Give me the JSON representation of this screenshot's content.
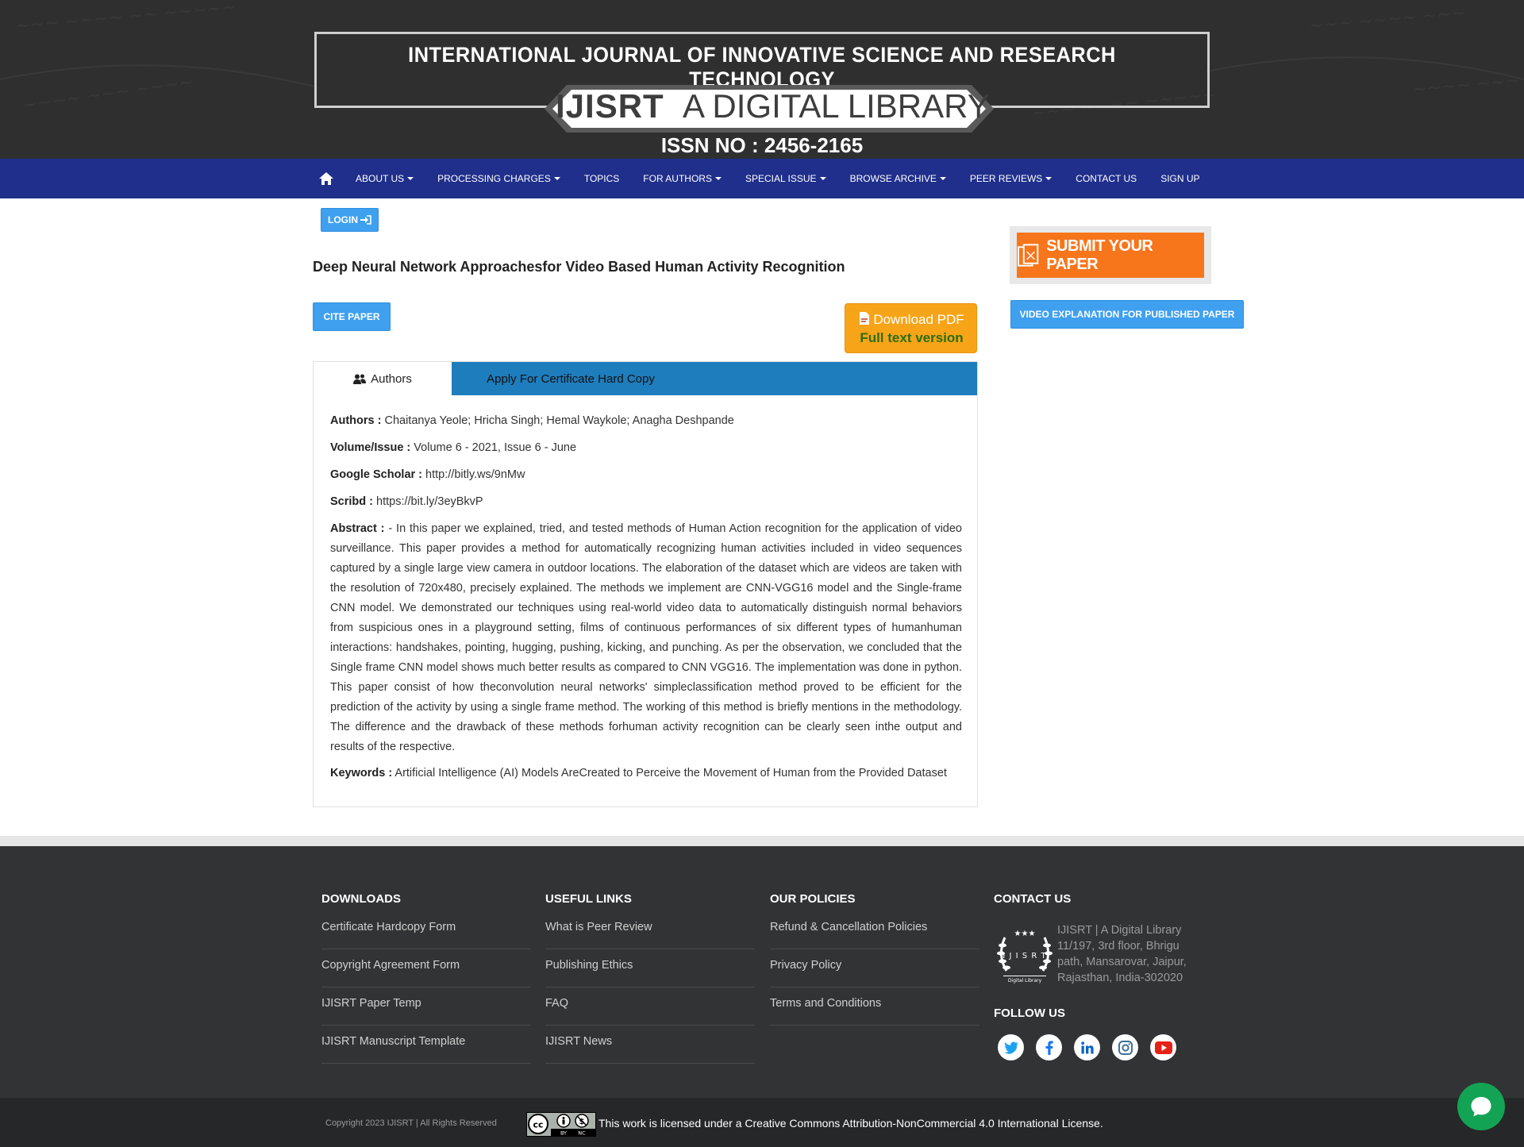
{
  "header": {
    "journal_title": "INTERNATIONAL JOURNAL OF INNOVATIVE SCIENCE AND RESEARCH TECHNOLOGY",
    "banner_abbrev": "IJISRT",
    "banner_text": "A DIGITAL LIBRARY",
    "issn": "ISSN NO : 2456-2165"
  },
  "nav": {
    "items": [
      {
        "label": "ABOUT US",
        "dropdown": true
      },
      {
        "label": "PROCESSING CHARGES",
        "dropdown": true
      },
      {
        "label": "TOPICS",
        "dropdown": false
      },
      {
        "label": "FOR AUTHORS",
        "dropdown": true
      },
      {
        "label": "SPECIAL ISSUE",
        "dropdown": true
      },
      {
        "label": "BROWSE ARCHIVE",
        "dropdown": true
      },
      {
        "label": "PEER REVIEWS",
        "dropdown": true
      },
      {
        "label": "CONTACT US",
        "dropdown": false
      },
      {
        "label": "SIGN UP",
        "dropdown": false
      }
    ]
  },
  "main": {
    "login_label": "LOGIN",
    "paper_title": "Deep Neural Network Approachesfor Video Based Human Activity Recognition",
    "cite_label": "CITE PAPER",
    "download_line1": "Download PDF",
    "download_line2": "Full text version",
    "tabs": [
      "Authors",
      "Apply For Certificate Hard Copy"
    ],
    "fields": {
      "authors_label": "Authors :",
      "authors_value": "Chaitanya Yeole; Hricha Singh; Hemal Waykole; Anagha Deshpande",
      "volume_label": "Volume/Issue :",
      "volume_value": "Volume 6 - 2021, Issue 6 - June",
      "scholar_label": "Google Scholar :",
      "scholar_value": "http://bitly.ws/9nMw",
      "scribd_label": "Scribd :",
      "scribd_value": "https://bit.ly/3eyBkvP",
      "abstract_label": "Abstract :",
      "abstract_value": "- In this paper we explained, tried, and tested methods of Human Action recognition for the application of video surveillance. This paper provides a method for automatically recognizing human activities included in video sequences captured by a single large view camera in outdoor locations. The elaboration of the dataset which are videos are taken with the resolution of 720x480, precisely explained. The methods we implement are CNN-VGG16 model and the Single-frame CNN model. We demonstrated our techniques using real-world video data to automatically distinguish normal behaviors from suspicious ones in a playground setting, films of continuous performances of six different types of humanhuman interactions: handshakes, pointing, hugging, pushing, kicking, and punching. As per the observation, we concluded that the Single frame CNN model shows much better results as compared to CNN VGG16. The implementation was done in python. This paper consist of how theconvolution neural networks' simpleclassification method proved to be efficient for the prediction of the activity by using a single frame method. The working of this method is briefly mentions in the methodology. The difference and the drawback of these methods forhuman activity recognition can be clearly seen inthe output and results of the respective.",
      "keywords_label": "Keywords :",
      "keywords_value": "Artificial Intelligence (AI) Models AreCreated to Perceive the Movement of Human from the Provided Dataset"
    }
  },
  "sidebar": {
    "submit_label": "SUBMIT YOUR PAPER",
    "video_label": "VIDEO EXPLANATION FOR PUBLISHED PAPER"
  },
  "footer": {
    "downloads": {
      "heading": "DOWNLOADS",
      "links": [
        "Certificate Hardcopy Form",
        "Copyright Agreement Form",
        "IJISRT Paper Temp",
        "IJISRT Manuscript Template"
      ]
    },
    "useful": {
      "heading": "USEFUL LINKS",
      "links": [
        "What is Peer Review",
        "Publishing Ethics",
        "FAQ",
        "IJISRT News"
      ]
    },
    "policies": {
      "heading": "OUR POLICIES",
      "links": [
        "Refund & Cancellation Policies",
        "Privacy Policy",
        "Terms and Conditions"
      ]
    },
    "contact": {
      "heading": "CONTACT US",
      "address": "IJISRT | A Digital Library 11/197, 3rd floor, Bhrigu path, Mansarovar, Jaipur, Rajasthan, India-302020",
      "logo_text": "IJISRT",
      "logo_sub": "Digital Library"
    },
    "follow_heading": "FOLLOW US",
    "socials": [
      "twitter-icon",
      "facebook-icon",
      "linkedin-icon",
      "instagram-icon",
      "youtube-icon"
    ],
    "copyright": "Copyright 2023 IJISRT | All Rights Reserved",
    "license": "This work is licensed under a Creative Commons Attribution-NonCommercial 4.0 International License."
  },
  "colors": {
    "nav": "#1f2f8b",
    "accent_blue": "#3fa0f0",
    "tab_blue": "#1e7dbd",
    "download_orange": "#f7a418",
    "submit_orange": "#f7761c",
    "footer": "#323334",
    "chat_green": "#13a354"
  }
}
